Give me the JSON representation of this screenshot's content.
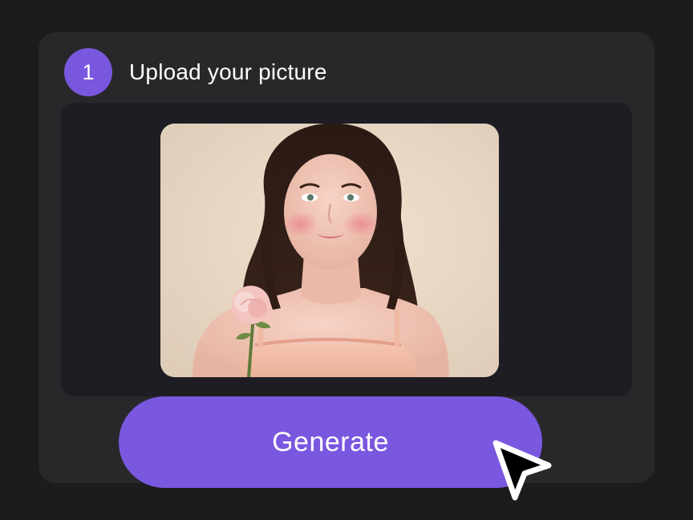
{
  "step": {
    "number": "1",
    "title": "Upload your picture"
  },
  "upload": {
    "image_icon": "portrait-photo"
  },
  "actions": {
    "generate_label": "Generate"
  },
  "cursor": {
    "icon": "mouse-pointer-icon"
  },
  "colors": {
    "background": "#1c1c1f",
    "panel": "#28282b",
    "upload_area": "#1e1d23",
    "accent": "#7a57df",
    "text": "#ffffff"
  }
}
